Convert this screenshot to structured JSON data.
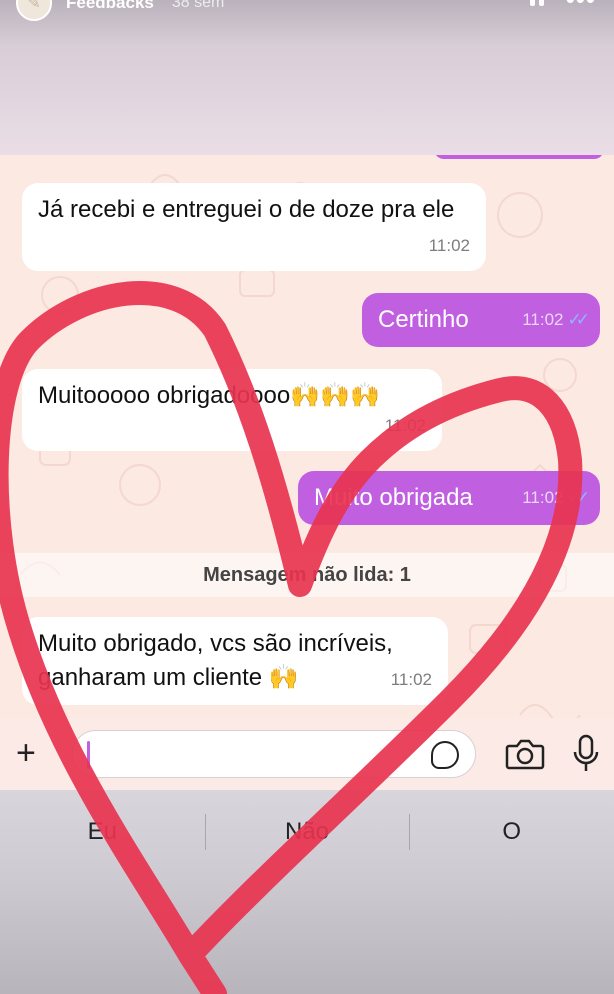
{
  "story": {
    "name": "Feedbacks",
    "time": "38 sem"
  },
  "chat": {
    "messages": [
      {
        "direction": "in",
        "text": "Já recebi e entreguei o de doze pra ele",
        "time": "11:02"
      },
      {
        "direction": "out",
        "text": "Certinho",
        "time": "11:02",
        "ticks": "✓✓"
      },
      {
        "direction": "in",
        "text": "Muitooooo obrigadoooo🙌🙌🙌",
        "time": "11:02"
      },
      {
        "direction": "out",
        "text": "Muito obrigada",
        "time": "11:02",
        "ticks": "✓✓"
      },
      {
        "direction": "in",
        "text": "Muito obrigado, vcs são incríveis, ganharam um cliente 🙌",
        "time": "11:02"
      }
    ],
    "unread_label": "Mensagem não lida: 1"
  },
  "input_bar": {
    "plus_icon": "plus-icon",
    "sticker_icon": "sticker-icon",
    "camera_icon": "camera-icon",
    "mic_icon": "microphone-icon"
  },
  "keyboard": {
    "suggestions": [
      "Eu",
      "Não",
      "O"
    ]
  },
  "colors": {
    "outgoing_bubble": "#c060e0",
    "incoming_bubble": "#ffffff",
    "chat_background": "#fbe9e2",
    "heart_stroke": "#e8334f",
    "read_ticks": "#8fb7ff"
  }
}
